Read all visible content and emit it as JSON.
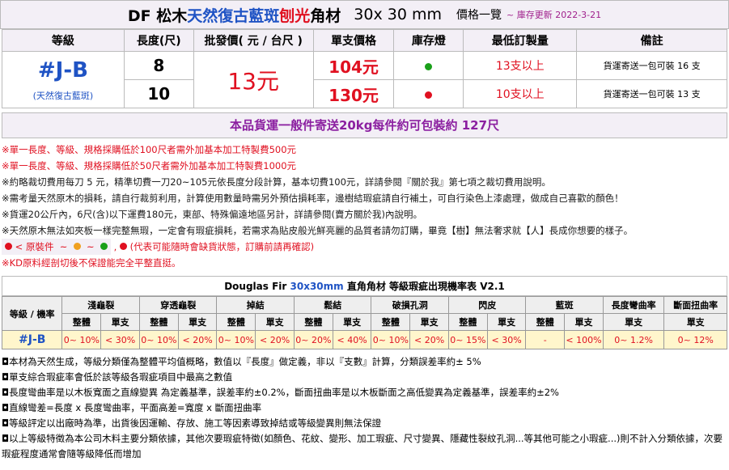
{
  "title": {
    "prefix": "DF 松木",
    "name_blue": "天然復古藍斑",
    "name_red": "刨光",
    "suffix": "角材",
    "size": "30x 30 mm",
    "price_list": "價格一覽",
    "updated": "~ 庫存更新 2022-3-21"
  },
  "price_table": {
    "headers": [
      "等級",
      "長度(尺)",
      "批發價( 元 / 台尺 )",
      "單支價格",
      "庫存燈",
      "最低訂製量",
      "備註"
    ],
    "grade": "#J-B",
    "grade_sub": "(天然復古藍斑)",
    "wholesale_price": "13元",
    "rows": [
      {
        "length": "8",
        "unit_price": "104元",
        "stock_color": "#1aa01a",
        "min_qty": "13支以上",
        "note": "貨運寄送一包可裝 16 支"
      },
      {
        "length": "10",
        "unit_price": "130元",
        "stock_color": "#e01020",
        "min_qty": "10支以上",
        "note": "貨運寄送一包可裝 13 支"
      }
    ]
  },
  "shipping_line": "本品貨運一般件寄送20kg每件約可包裝約 127尺",
  "notes": [
    "※單一長度、等級、規格採購低於100尺者需外加基本加工特製費500元",
    "※單一長度、等級、規格採購低於50尺者需外加基本加工特製費1000元",
    "※約略裁切費用每刀 5 元，精準切費一刀20~105元依長度分段計算，基本切費100元，詳請參閱『關於我』第七項之裁切費用說明。",
    "※需考量天然原木的損耗，請自行裁剪利用，計算使用數量時需另外預估損耗率，邊樹結瑕疵請自行補土，可自行染色上漆處理，做成自己喜歡的顏色！",
    "※貨運20公斤內，6尺(含)以下運費180元，東部、特殊偏遠地區另計，詳請參閱(賣方關於我)內說明。",
    "※天然原木無法如夾板一樣完整無瑕，一定會有瑕疵損耗，若需求為貼皮般光鮮亮麗的品質者請勿訂購，畢竟【樹】無法奢求就【人】長成你想要的樣子。"
  ],
  "legend": {
    "label": "< 原裝件",
    "tilde": "~",
    "dot_colors": [
      "#e01020",
      "#f0a020",
      "#1aa01a"
    ],
    "warning": "(代表可能隨時會缺貨狀態，訂購前請再確認)"
  },
  "kd_note": "※KD原料經剖切後不保證能完全平整直挺。",
  "defect_table": {
    "title_prefix": "Douglas Fir",
    "title_size": "30x30mm",
    "title_suffix": "直角角材 等級瑕疵出現機率表 V2.1",
    "grade_header": "等級 / 機率",
    "groups": [
      "淺龜裂",
      "穿透龜裂",
      "掉結",
      "鬆結",
      "破損孔洞",
      "閃皮",
      "藍斑",
      "長度彎曲率",
      "斷面扭曲率"
    ],
    "sub_whole": "整體",
    "sub_single": "單支",
    "row_grade": "#J-B",
    "values": [
      "0~ 10%",
      "< 30%",
      "0~ 10%",
      "< 20%",
      "0~ 10%",
      "< 20%",
      "0~ 20%",
      "< 40%",
      "0~ 10%",
      "< 20%",
      "0~ 15%",
      "< 30%",
      "-",
      "< 100%",
      "0~ 1.2%",
      "0~ 12%"
    ]
  },
  "footnotes": [
    "◘本材為天然生成，等級分類僅為整體平均值概略，數值以『長度』做定義，非以『支數』計算，分類誤差率約± 5%",
    "◘單支綜合瑕疵率會低於該等級各瑕疵項目中最高之數值",
    "◘長度彎曲率是以木板寬面之直線變異 為定義基準，誤差率約±0.2%，斷面扭曲率是以木板斷面之高低變異為定義基準，誤差率約±2%",
    "◘直線彎差=長度 x 長度彎曲率，平面高差=寬度 x 斷面扭曲率",
    "◘等級評定以出廠時為準，出貨後因運輸、存放、施工等因素導致掉結或等級變異則無法保證",
    "◘以上等級特徵為本公司木料主要分類依據，其他次要瑕疵特徵(如顏色、花紋、變形、加工瑕疵、尺寸變異、隱藏性裂紋孔洞...等其他可能之小瑕疵...)則不計入分類依據，次要瑕疵程度通常會隨等級降低而增加"
  ]
}
